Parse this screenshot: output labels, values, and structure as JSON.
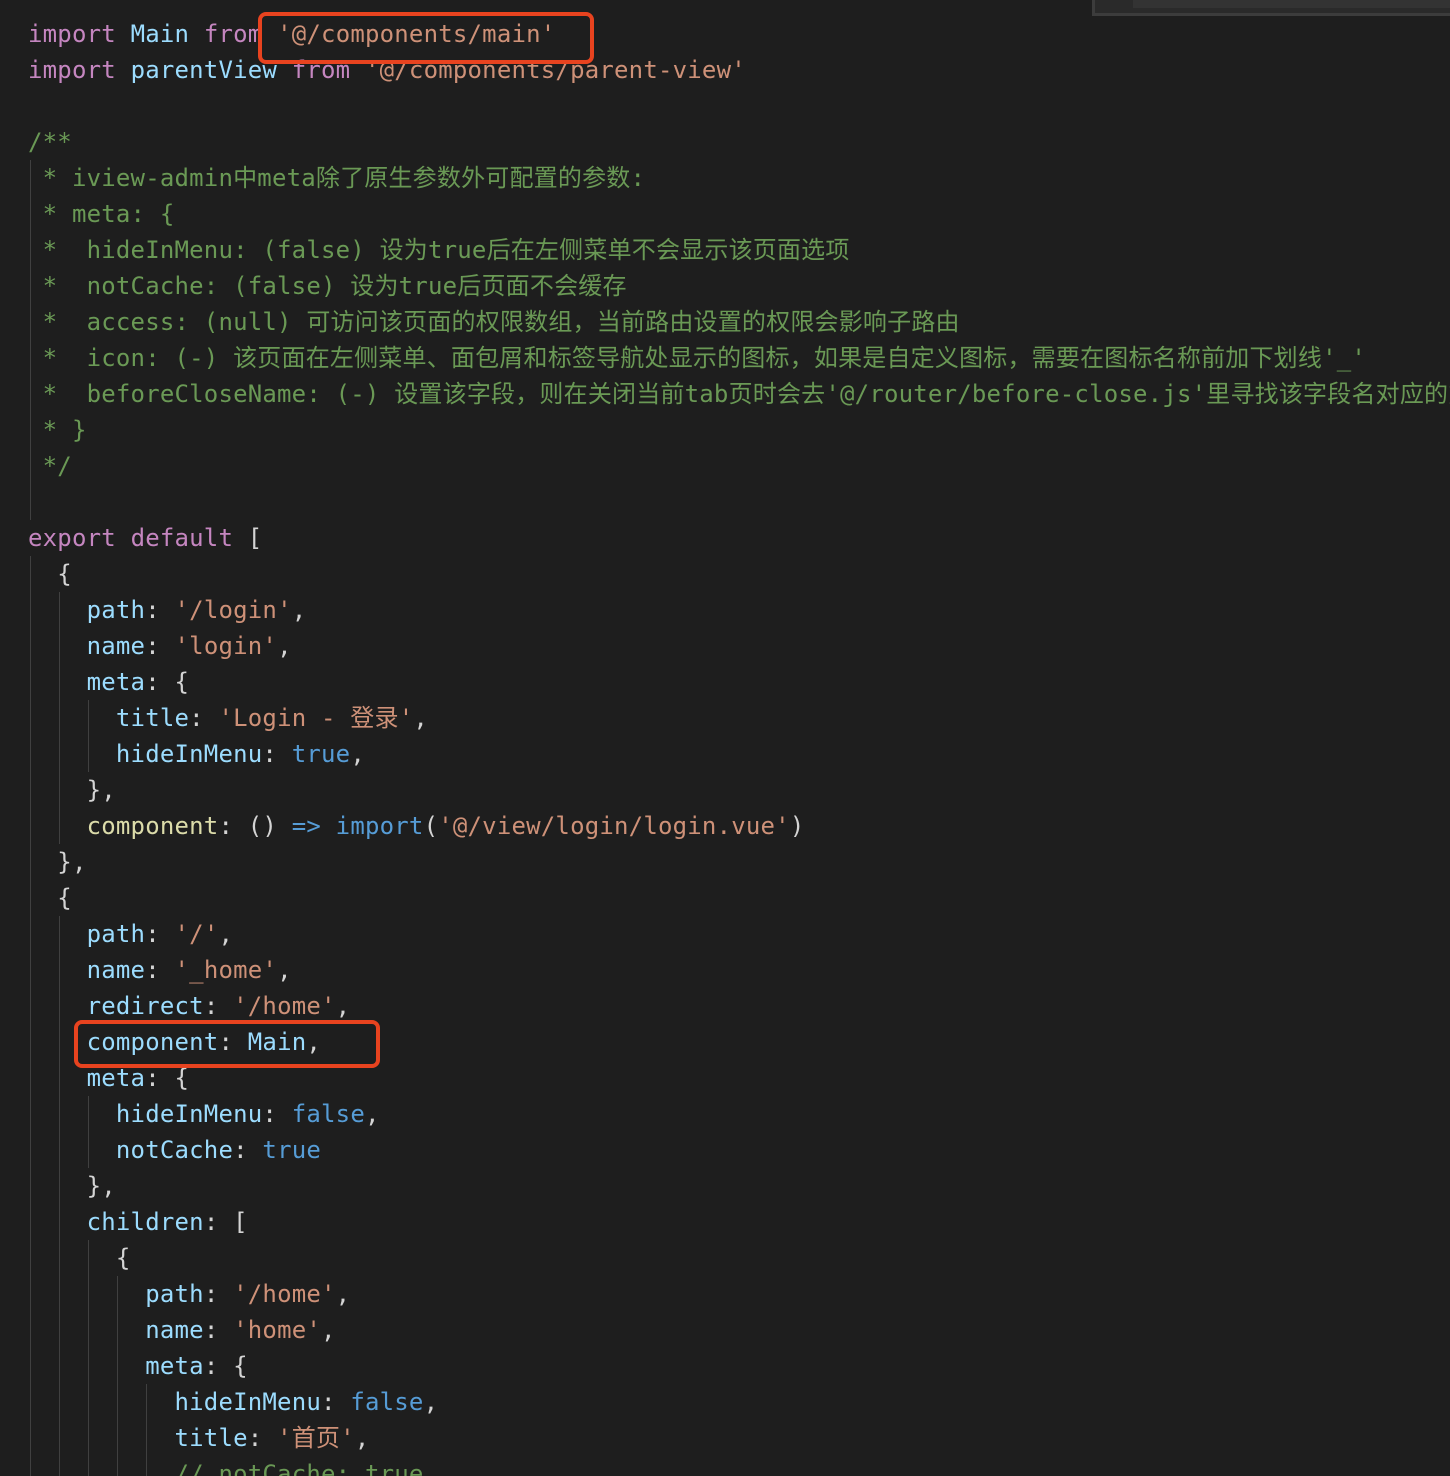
{
  "editor": {
    "lines": [
      [
        [
          "kw",
          "import"
        ],
        [
          "plain",
          " "
        ],
        [
          "var",
          "Main"
        ],
        [
          "plain",
          " "
        ],
        [
          "kw",
          "from"
        ],
        [
          "plain",
          " "
        ],
        [
          "str",
          "'@/components/main'"
        ]
      ],
      [
        [
          "kw",
          "import"
        ],
        [
          "plain",
          " "
        ],
        [
          "var",
          "parentView"
        ],
        [
          "plain",
          " "
        ],
        [
          "kw",
          "from"
        ],
        [
          "plain",
          " "
        ],
        [
          "str",
          "'@/components/parent-view'"
        ]
      ],
      [],
      [
        [
          "cm",
          "/**"
        ]
      ],
      [
        [
          "cm",
          " * iview-admin中meta除了原生参数外可配置的参数:"
        ]
      ],
      [
        [
          "cm",
          " * meta: {"
        ]
      ],
      [
        [
          "cm",
          " *  hideInMenu: (false) 设为true后在左侧菜单不会显示该页面选项"
        ]
      ],
      [
        [
          "cm",
          " *  notCache: (false) 设为true后页面不会缓存"
        ]
      ],
      [
        [
          "cm",
          " *  access: (null) 可访问该页面的权限数组，当前路由设置的权限会影响子路由"
        ]
      ],
      [
        [
          "cm",
          " *  icon: (-) 该页面在左侧菜单、面包屑和标签导航处显示的图标，如果是自定义图标，需要在图标名称前加下划线'_'"
        ]
      ],
      [
        [
          "cm",
          " *  beforeCloseName: (-) 设置该字段，则在关闭当前tab页时会去'@/router/before-close.js'里寻找该字段名对应的方"
        ]
      ],
      [
        [
          "cm",
          " * }"
        ]
      ],
      [
        [
          "cm",
          " */"
        ]
      ],
      [],
      [
        [
          "kw",
          "export"
        ],
        [
          "plain",
          " "
        ],
        [
          "kw",
          "default"
        ],
        [
          "plain",
          " ["
        ]
      ],
      [
        [
          "plain",
          "  {"
        ]
      ],
      [
        [
          "plain",
          "    "
        ],
        [
          "prop",
          "path"
        ],
        [
          "plain",
          ": "
        ],
        [
          "str",
          "'/login'"
        ],
        [
          "plain",
          ","
        ]
      ],
      [
        [
          "plain",
          "    "
        ],
        [
          "prop",
          "name"
        ],
        [
          "plain",
          ": "
        ],
        [
          "str",
          "'login'"
        ],
        [
          "plain",
          ","
        ]
      ],
      [
        [
          "plain",
          "    "
        ],
        [
          "prop",
          "meta"
        ],
        [
          "plain",
          ": {"
        ]
      ],
      [
        [
          "plain",
          "      "
        ],
        [
          "prop",
          "title"
        ],
        [
          "plain",
          ": "
        ],
        [
          "str",
          "'Login - 登录'"
        ],
        [
          "plain",
          ","
        ]
      ],
      [
        [
          "plain",
          "      "
        ],
        [
          "prop",
          "hideInMenu"
        ],
        [
          "plain",
          ": "
        ],
        [
          "bool",
          "true"
        ],
        [
          "plain",
          ","
        ]
      ],
      [
        [
          "plain",
          "    },"
        ]
      ],
      [
        [
          "plain",
          "    "
        ],
        [
          "fn",
          "component"
        ],
        [
          "plain",
          ": () "
        ],
        [
          "op",
          "=>"
        ],
        [
          "plain",
          " "
        ],
        [
          "bool",
          "import"
        ],
        [
          "plain",
          "("
        ],
        [
          "str",
          "'@/view/login/login.vue'"
        ],
        [
          "plain",
          ")"
        ]
      ],
      [
        [
          "plain",
          "  },"
        ]
      ],
      [
        [
          "plain",
          "  {"
        ]
      ],
      [
        [
          "plain",
          "    "
        ],
        [
          "prop",
          "path"
        ],
        [
          "plain",
          ": "
        ],
        [
          "str",
          "'/'"
        ],
        [
          "plain",
          ","
        ]
      ],
      [
        [
          "plain",
          "    "
        ],
        [
          "prop",
          "name"
        ],
        [
          "plain",
          ": "
        ],
        [
          "str",
          "'_home'"
        ],
        [
          "plain",
          ","
        ]
      ],
      [
        [
          "plain",
          "    "
        ],
        [
          "prop",
          "redirect"
        ],
        [
          "plain",
          ": "
        ],
        [
          "str",
          "'/home'"
        ],
        [
          "plain",
          ","
        ]
      ],
      [
        [
          "plain",
          "    "
        ],
        [
          "prop",
          "component"
        ],
        [
          "plain",
          ": "
        ],
        [
          "var",
          "Main"
        ],
        [
          "plain",
          ","
        ]
      ],
      [
        [
          "plain",
          "    "
        ],
        [
          "prop",
          "meta"
        ],
        [
          "plain",
          ": {"
        ]
      ],
      [
        [
          "plain",
          "      "
        ],
        [
          "prop",
          "hideInMenu"
        ],
        [
          "plain",
          ": "
        ],
        [
          "bool",
          "false"
        ],
        [
          "plain",
          ","
        ]
      ],
      [
        [
          "plain",
          "      "
        ],
        [
          "prop",
          "notCache"
        ],
        [
          "plain",
          ": "
        ],
        [
          "bool",
          "true"
        ]
      ],
      [
        [
          "plain",
          "    },"
        ]
      ],
      [
        [
          "plain",
          "    "
        ],
        [
          "prop",
          "children"
        ],
        [
          "plain",
          ": ["
        ]
      ],
      [
        [
          "plain",
          "      {"
        ]
      ],
      [
        [
          "plain",
          "        "
        ],
        [
          "prop",
          "path"
        ],
        [
          "plain",
          ": "
        ],
        [
          "str",
          "'/home'"
        ],
        [
          "plain",
          ","
        ]
      ],
      [
        [
          "plain",
          "        "
        ],
        [
          "prop",
          "name"
        ],
        [
          "plain",
          ": "
        ],
        [
          "str",
          "'home'"
        ],
        [
          "plain",
          ","
        ]
      ],
      [
        [
          "plain",
          "        "
        ],
        [
          "prop",
          "meta"
        ],
        [
          "plain",
          ": {"
        ]
      ],
      [
        [
          "plain",
          "          "
        ],
        [
          "prop",
          "hideInMenu"
        ],
        [
          "plain",
          ": "
        ],
        [
          "bool",
          "false"
        ],
        [
          "plain",
          ","
        ]
      ],
      [
        [
          "plain",
          "          "
        ],
        [
          "prop",
          "title"
        ],
        [
          "plain",
          ": "
        ],
        [
          "str",
          "'首页'"
        ],
        [
          "plain",
          ","
        ]
      ],
      [
        [
          "plain",
          "          "
        ],
        [
          "cm",
          "// notCache: true"
        ]
      ]
    ]
  },
  "colors": {
    "background": "#1e1e1e",
    "highlight_border": "#e8431f",
    "keyword": "#c586c0",
    "variable": "#9cdcfe",
    "string": "#ce9178",
    "comment": "#6a9955",
    "boolean": "#569cd6",
    "function": "#dcdcaa"
  }
}
